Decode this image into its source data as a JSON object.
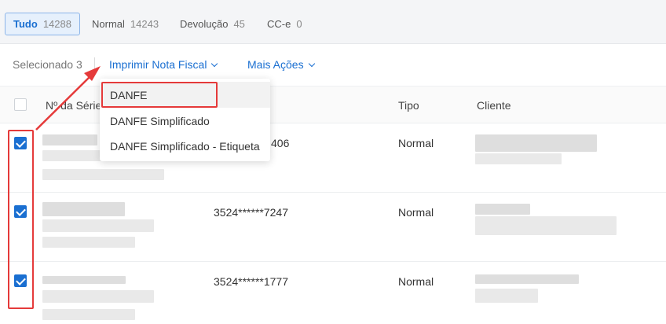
{
  "tabs": [
    {
      "label": "Tudo",
      "count": "14288"
    },
    {
      "label": "Normal",
      "count": "14243"
    },
    {
      "label": "Devolução",
      "count": "45"
    },
    {
      "label": "CC-e",
      "count": "0"
    }
  ],
  "toolbar": {
    "selected_label": "Selecionado 3",
    "print_label": "Imprimir Nota Fiscal",
    "more_label": "Mais Ações"
  },
  "dropdown": {
    "items": [
      "DANFE",
      "DANFE Simplificado",
      "DANFE Simplificado - Etiqueta"
    ]
  },
  "table": {
    "headers": {
      "serie": "Nº da Série",
      "tipo": "Tipo",
      "cliente": "Cliente"
    },
    "rows": [
      {
        "chave": "406",
        "tipo": "Normal",
        "checked": true
      },
      {
        "chave": "3524******7247",
        "tipo": "Normal",
        "checked": true
      },
      {
        "chave": "3524******1777",
        "tipo": "Normal",
        "checked": true
      }
    ]
  },
  "colors": {
    "accent": "#1a6fd1",
    "highlight": "#e53a3a"
  }
}
